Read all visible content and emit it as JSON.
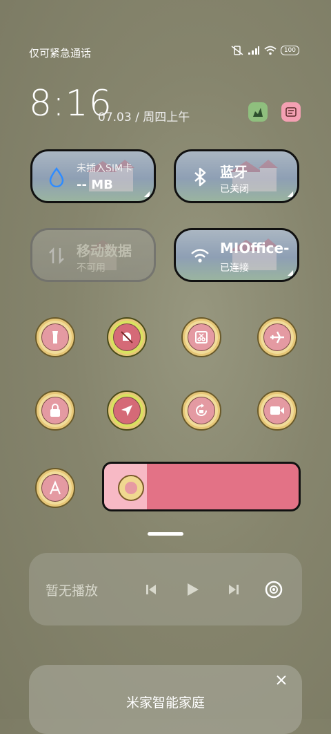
{
  "status": {
    "carrier_text": "仅可紧急通话",
    "battery": "100"
  },
  "clock": {
    "time": "8:16",
    "date": "07.03 / 周四上午"
  },
  "tiles": [
    {
      "title": "未插入SIM卡",
      "value": "-- MB",
      "icon": "water-drop-icon"
    },
    {
      "title": "蓝牙",
      "sub": "已关闭",
      "icon": "bluetooth-icon"
    },
    {
      "title": "移动数据",
      "sub": "不可用",
      "icon": "mobile-data-icon"
    },
    {
      "title": "MIOffice-",
      "sub": "已连接",
      "icon": "wifi-icon"
    }
  ],
  "toggles": [
    "flashlight-icon",
    "mute-bell-icon",
    "screenshot-scissors-icon",
    "airplane-icon",
    "lock-icon",
    "location-icon",
    "rotation-lock-icon",
    "screen-record-icon",
    "auto-brightness-icon"
  ],
  "brightness": {
    "level": 0.22
  },
  "media": {
    "label": "暂无播放"
  },
  "home": {
    "title": "米家智能家庭"
  },
  "colors": {
    "tile_border": "#111111",
    "pink": "#e37286",
    "light_pink": "#f7b9c5",
    "flower": "#f1dc9a"
  }
}
